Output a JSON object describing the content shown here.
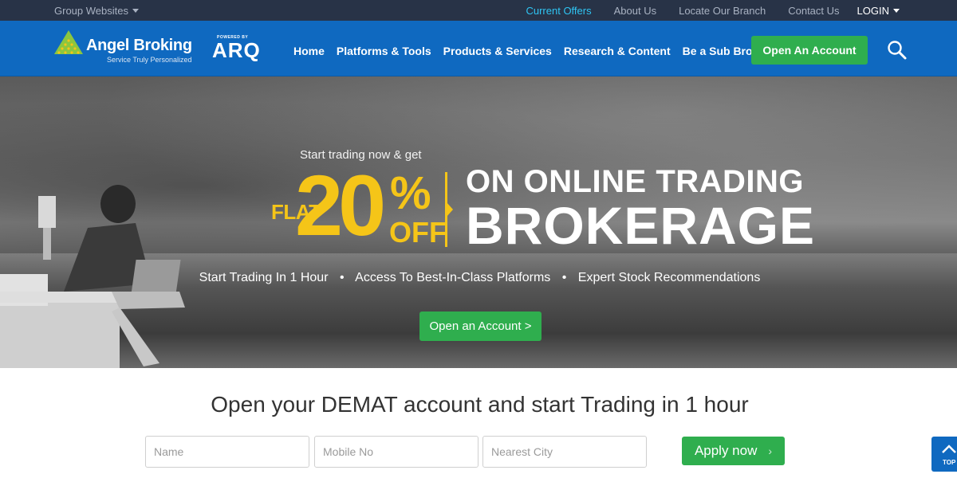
{
  "util_bar": {
    "group_websites": "Group Websites",
    "links": [
      {
        "label": "Current Offers",
        "highlight": true
      },
      {
        "label": "About Us",
        "highlight": false
      },
      {
        "label": "Locate Our Branch",
        "highlight": false
      },
      {
        "label": "Contact Us",
        "highlight": false
      }
    ],
    "login": "LOGIN"
  },
  "header": {
    "brand": "Angel Broking",
    "tagline": "Service Truly Personalized",
    "powered_by": "POWERED BY",
    "arq": "ARQ",
    "nav": [
      "Home",
      "Platforms & Tools",
      "Products & Services",
      "Research & Content",
      "Be a Sub Broker"
    ],
    "open_account": "Open An Account"
  },
  "hero": {
    "kicker": "Start trading now & get",
    "flat": "FLAT",
    "percent_value": "20",
    "percent_sign": "%",
    "off": "OFF",
    "line1": "ON ONLINE TRADING",
    "line2": "BROKERAGE",
    "features": [
      "Start Trading In 1 Hour",
      "Access To Best-In-Class Platforms",
      "Expert Stock Recommendations"
    ],
    "feature_separator": "•",
    "cta": "Open an Account >"
  },
  "form": {
    "title": "Open your DEMAT account and start Trading in 1 hour",
    "name_placeholder": "Name",
    "mobile_placeholder": "Mobile No",
    "city_placeholder": "Nearest City",
    "apply": "Apply now",
    "apply_chevron": "›"
  },
  "back_to_top": "TOP",
  "colors": {
    "util_bg": "#283347",
    "header_bg": "#0f69c0",
    "highlight_link": "#2fc5f3",
    "cta_green": "#2fae4e",
    "offer_yellow": "#f5c518"
  },
  "icons": [
    "chevron-down-icon",
    "angel-logo-icon",
    "search-icon",
    "arrow-up-icon"
  ]
}
